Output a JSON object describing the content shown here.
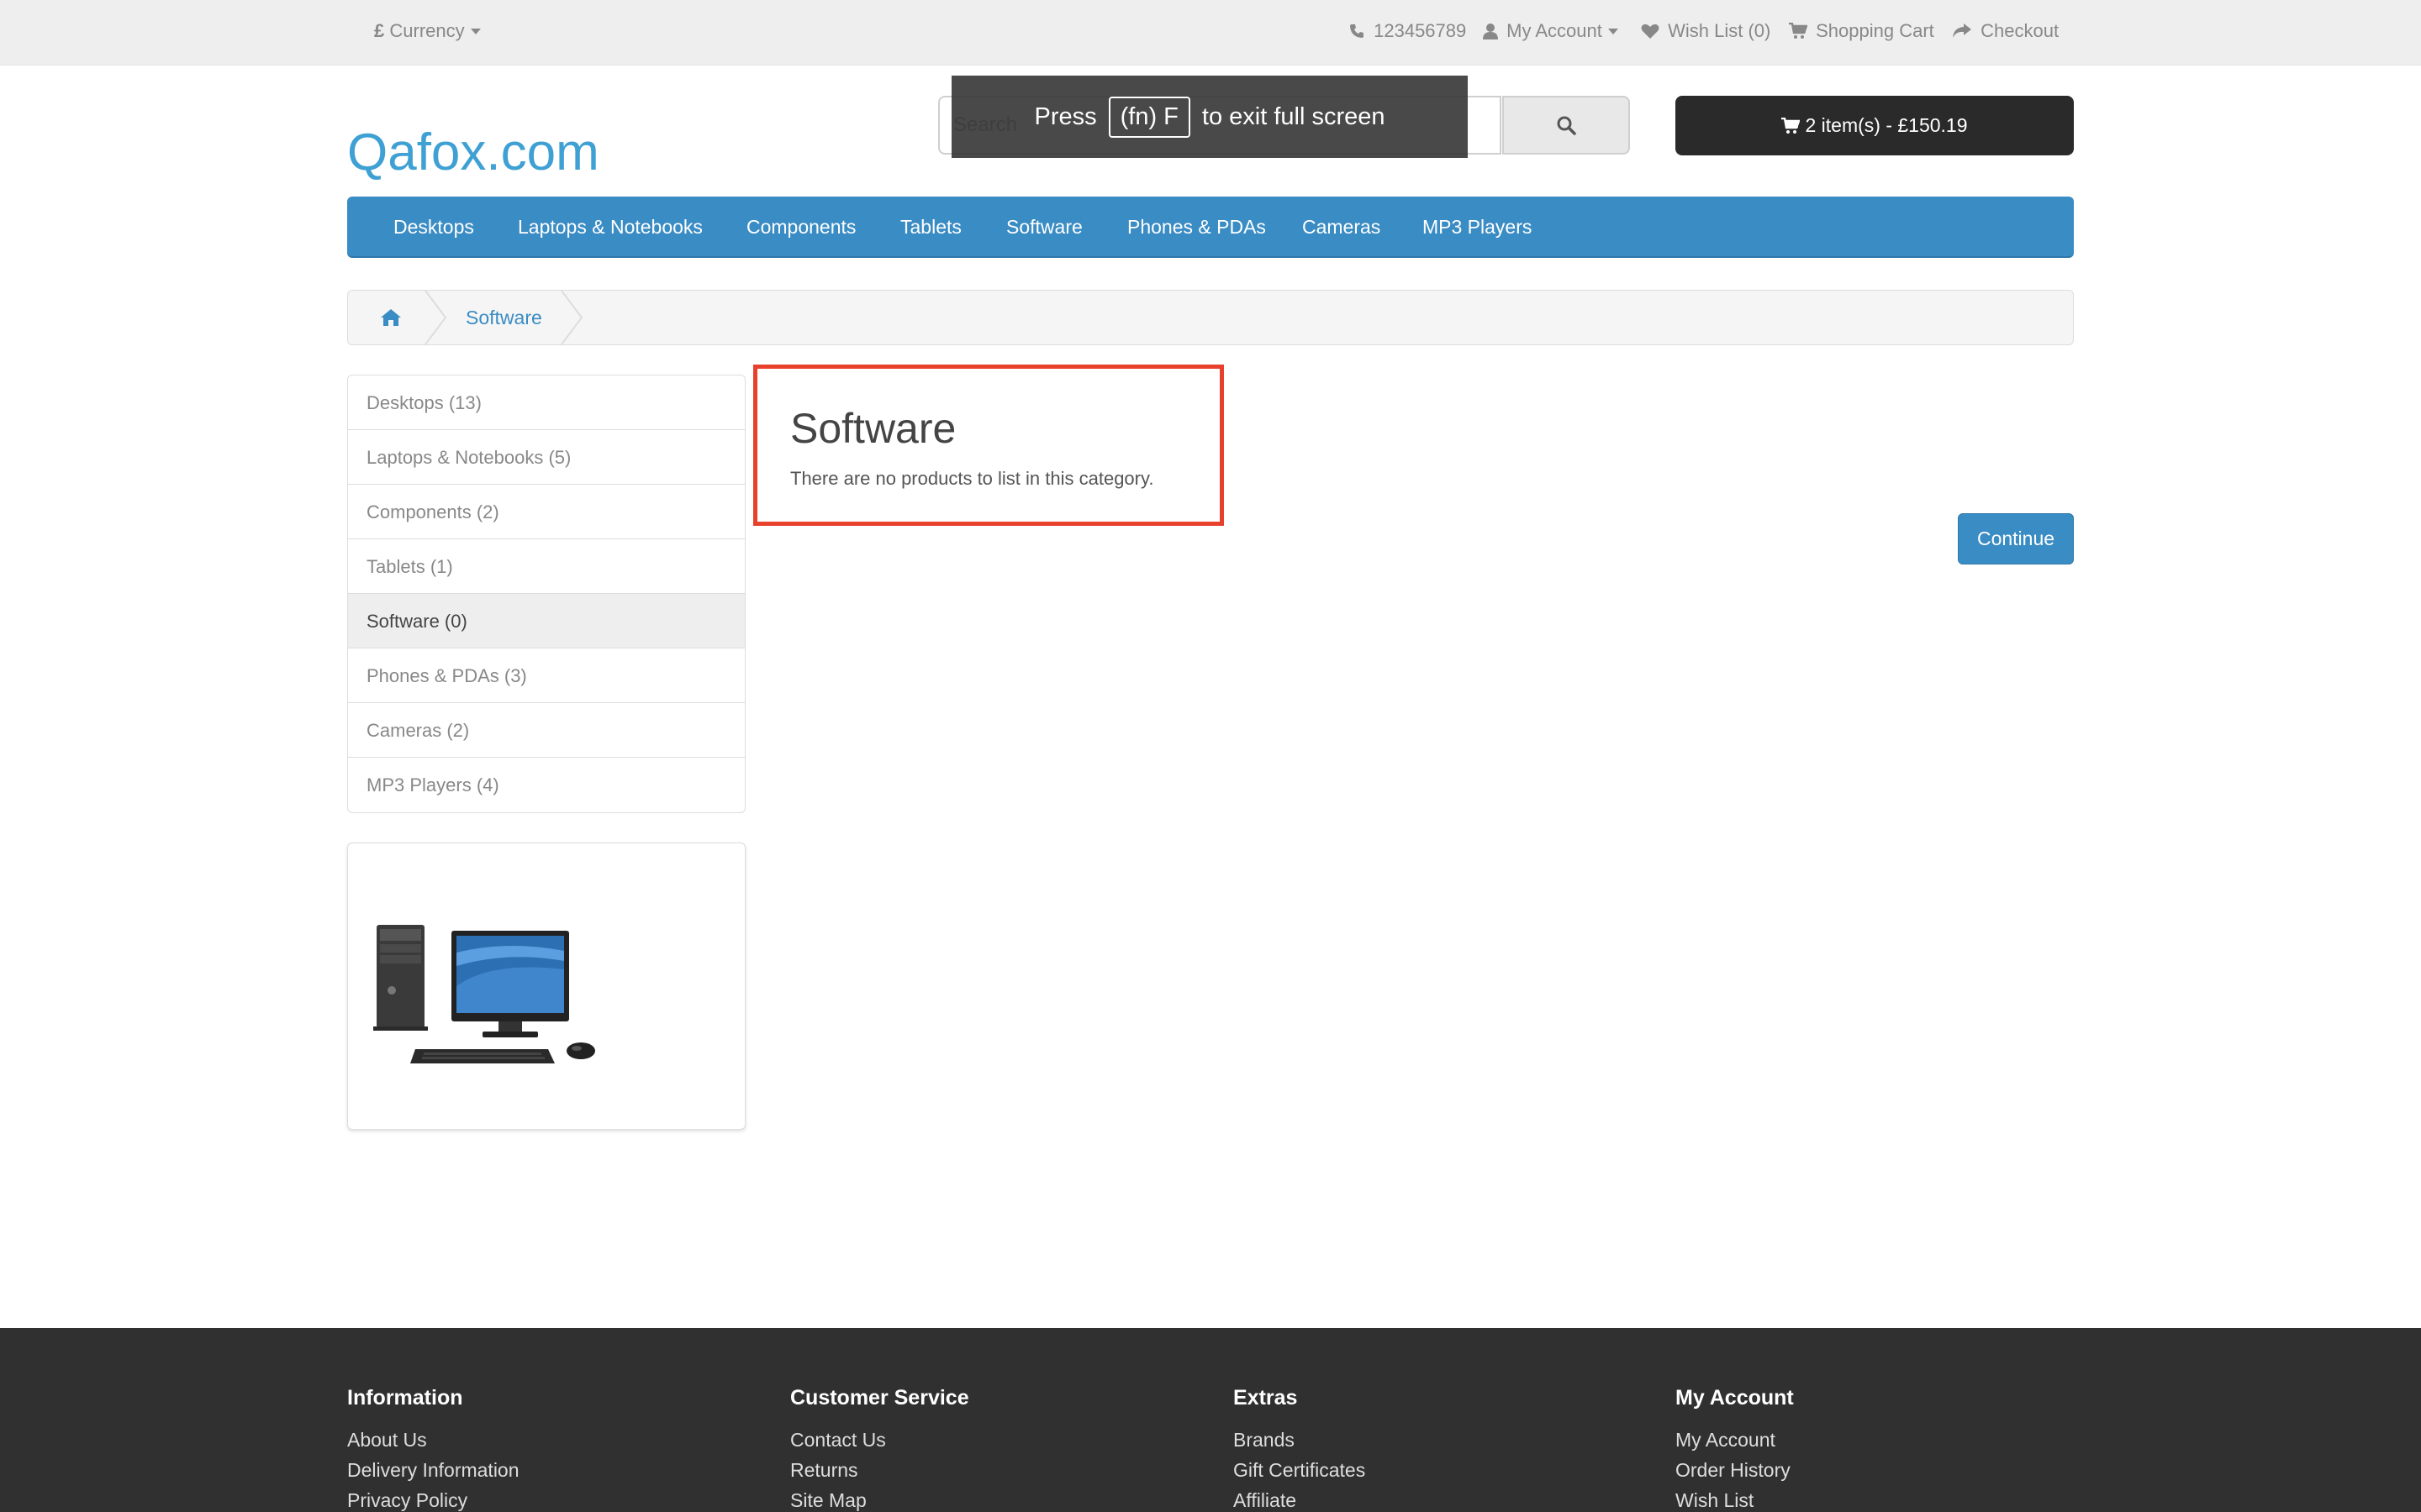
{
  "topbar": {
    "currency_label": "Currency",
    "currency_symbol": "£",
    "phone": "123456789",
    "my_account": "My Account",
    "wish_list": "Wish List (0)",
    "shopping_cart": "Shopping Cart",
    "checkout": "Checkout"
  },
  "header": {
    "logo": "Qafox.com",
    "search_placeholder": "Search",
    "cart_summary": "2 item(s) - £150.19"
  },
  "overlay": {
    "press": "Press",
    "key": "(fn) F",
    "message": "to exit full screen"
  },
  "menu": {
    "items": [
      "Desktops",
      "Laptops & Notebooks",
      "Components",
      "Tablets",
      "Software",
      "Phones & PDAs",
      "Cameras",
      "MP3 Players"
    ]
  },
  "breadcrumb": {
    "current": "Software"
  },
  "sidebar": {
    "categories": [
      "Desktops (13)",
      "Laptops & Notebooks (5)",
      "Components (2)",
      "Tablets (1)",
      "Software (0)",
      "Phones & PDAs (3)",
      "Cameras (2)",
      "MP3 Players (4)"
    ],
    "active": "Software (0)"
  },
  "content": {
    "title": "Software",
    "empty_message": "There are no products to list in this category.",
    "continue_label": "Continue"
  },
  "footer": {
    "information": {
      "heading": "Information",
      "links": [
        "About Us",
        "Delivery Information",
        "Privacy Policy"
      ]
    },
    "customer_service": {
      "heading": "Customer Service",
      "links": [
        "Contact Us",
        "Returns",
        "Site Map"
      ]
    },
    "extras": {
      "heading": "Extras",
      "links": [
        "Brands",
        "Gift Certificates",
        "Affiliate"
      ]
    },
    "my_account": {
      "heading": "My Account",
      "links": [
        "My Account",
        "Order History",
        "Wish List"
      ]
    }
  },
  "colors": {
    "link_blue": "#3a8cc4",
    "logo_blue": "#3fa0d3",
    "highlight_red": "#e7412d",
    "cart_dark": "#2a2a2a",
    "footer_dark": "#303030"
  }
}
